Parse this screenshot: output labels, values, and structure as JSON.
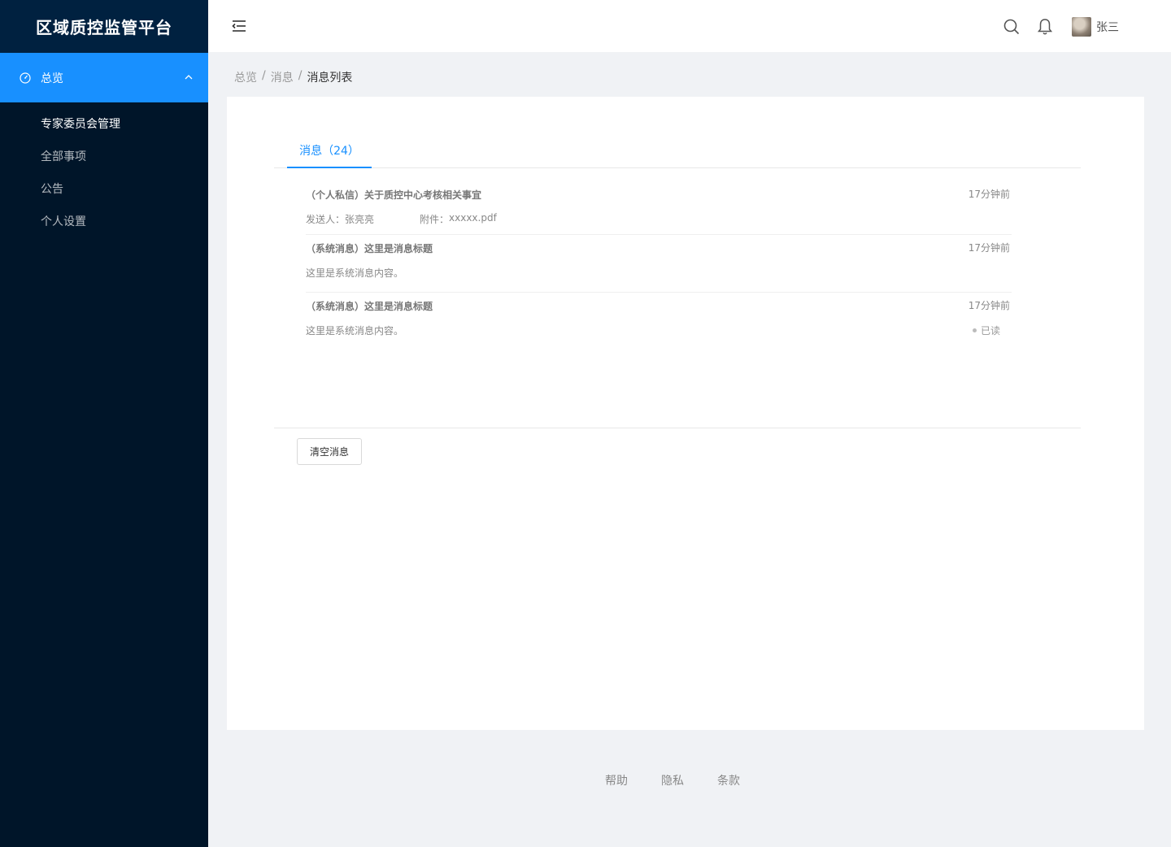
{
  "app": {
    "title": "区域质控监管平台"
  },
  "sidebar": {
    "group": {
      "label": "总览",
      "icon": "dashboard-icon",
      "expanded": true
    },
    "items": [
      {
        "label": "专家委员会管理",
        "active": true
      },
      {
        "label": "全部事项",
        "active": false
      },
      {
        "label": "公告",
        "active": false
      },
      {
        "label": "个人设置",
        "active": false
      }
    ]
  },
  "header": {
    "user_name": "张三",
    "icons": [
      "menu-fold-icon",
      "search-icon",
      "bell-icon"
    ]
  },
  "breadcrumb": {
    "items": [
      "总览",
      "消息",
      "消息列表"
    ],
    "separator": "/"
  },
  "tabs": [
    {
      "label": "消息（24）",
      "active": true
    }
  ],
  "messages": [
    {
      "title": "（个人私信）关于质控中心考核相关事宜",
      "time": "17分钟前",
      "sender": "发送人：张亮亮",
      "attachment_label": "附件：",
      "attachment_name": "xxxxx.pdf"
    },
    {
      "title": "（系统消息）这里是消息标题",
      "time": "17分钟前",
      "content": "这里是系统消息内容。"
    },
    {
      "title": "（系统消息）这里是消息标题",
      "time": "17分钟前",
      "content": "这里是系统消息内容。",
      "status": "已读"
    }
  ],
  "actions": {
    "clear_label": "清空消息"
  },
  "footer": {
    "links": [
      "帮助",
      "隐私",
      "条款"
    ]
  },
  "colors": {
    "sidebar_bg": "#001529",
    "logo_bg": "#002140",
    "accent": "#1890ff",
    "page_bg": "#f0f2f5"
  }
}
